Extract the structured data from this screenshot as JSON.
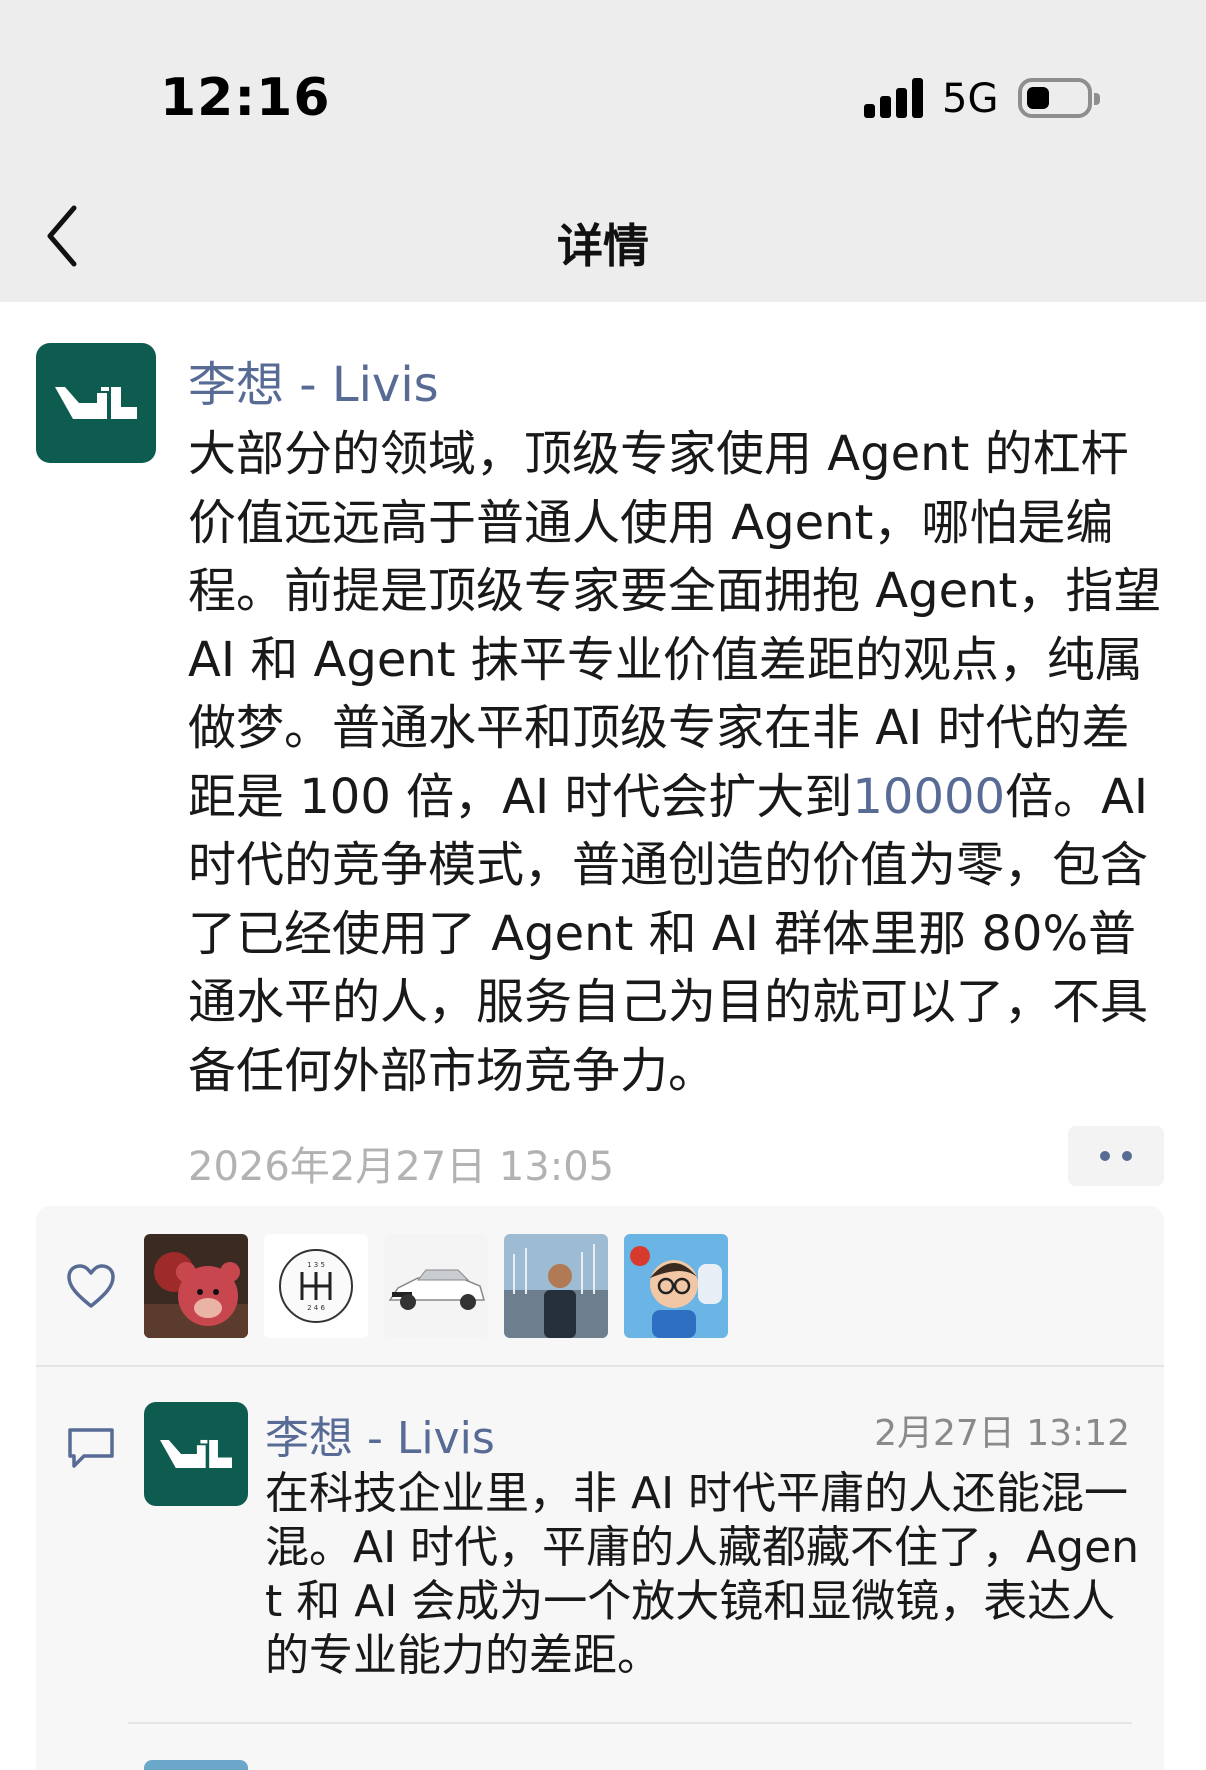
{
  "status_bar": {
    "time": "12:16",
    "network": "5G",
    "battery_icon": "battery-icon"
  },
  "nav": {
    "title": "详情",
    "back_icon": "chevron-left-icon"
  },
  "post": {
    "author": "李想 - Livis",
    "body_before": "大部分的领域，顶级专家使用 Agent 的杠杆价值远远高于普通人使用 Agent，哪怕是编程。前提是顶级专家要全面拥抱 Agent，指望 AI 和 Agent 抹平专业价值差距的观点，纯属做梦。普通水平和顶级专家在非 AI 时代的差距是 100 倍，AI 时代会扩大到",
    "body_highlight": "10000",
    "body_after": "倍。AI 时代的竞争模式，普通创造的价值为零，包含了已经使用了 Agent 和 AI 群体里那 80%普通水平的人，服务自己为目的就可以了，不具备任何外部市场竞争力。",
    "timestamp": "2026年2月27日 13:05"
  },
  "likes": {
    "icon": "heart-icon",
    "avatars": [
      "bear-avatar",
      "gear-shift-avatar",
      "car-avatar",
      "person-harbor-avatar",
      "cartoon-boy-avatar"
    ]
  },
  "comments": [
    {
      "author": "李想 - Livis",
      "time": "2月27日 13:12",
      "text": "在科技企业里，非 AI 时代平庸的人还能混一混。AI 时代，平庸的人藏都藏不住了，Agent 和 AI 会成为一个放大镜和显微镜，表达人的专业能力的差距。"
    }
  ],
  "colors": {
    "link": "#576b95",
    "avatar_bg": "#0e5c4f",
    "header_bg": "#ededed"
  }
}
